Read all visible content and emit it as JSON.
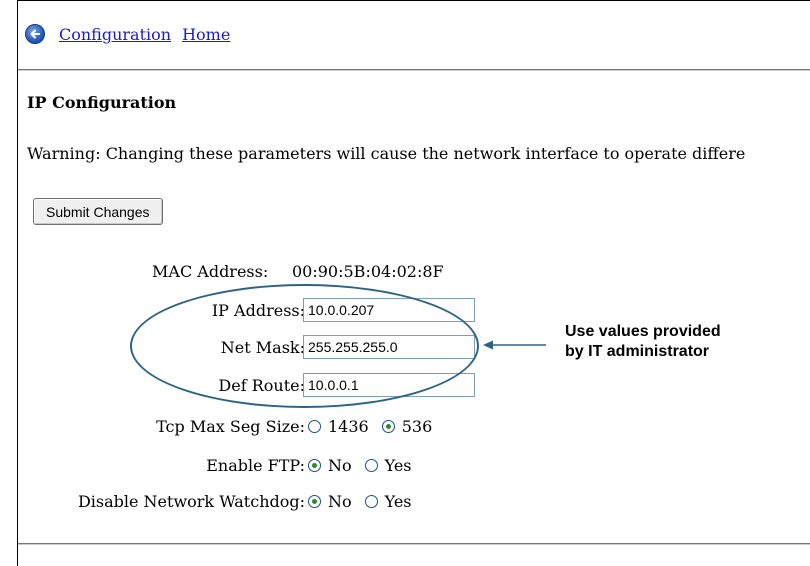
{
  "nav": {
    "links": [
      "Configuration",
      "Home"
    ]
  },
  "page": {
    "title": "IP Configuration",
    "warning": "Warning: Changing these parameters will cause the network interface to operate differe",
    "submit_label": "Submit Changes"
  },
  "form": {
    "mac": {
      "label": "MAC Address:",
      "value": "00:90:5B:04:02:8F"
    },
    "ip": {
      "label": "IP Address:",
      "value": "10.0.0.207"
    },
    "mask": {
      "label": "Net Mask:",
      "value": "255.255.255.0"
    },
    "route": {
      "label": "Def Route:",
      "value": "10.0.0.1"
    },
    "tcp": {
      "label": "Tcp Max Seg Size:",
      "options": [
        "1436",
        "536"
      ],
      "selected": "536"
    },
    "ftp": {
      "label": "Enable FTP:",
      "options": [
        "No",
        "Yes"
      ],
      "selected": "No"
    },
    "watchdog": {
      "label": "Disable Network Watchdog:",
      "options": [
        "No",
        "Yes"
      ],
      "selected": "No"
    }
  },
  "annotation": {
    "line1": "Use values provided",
    "line2": "by IT administrator"
  },
  "colors": {
    "link": "#1a1acc",
    "callout_outline": "#2d6482",
    "radio_dot": "#2a8a2a"
  },
  "icons": {
    "back": "back-arrow-icon"
  }
}
